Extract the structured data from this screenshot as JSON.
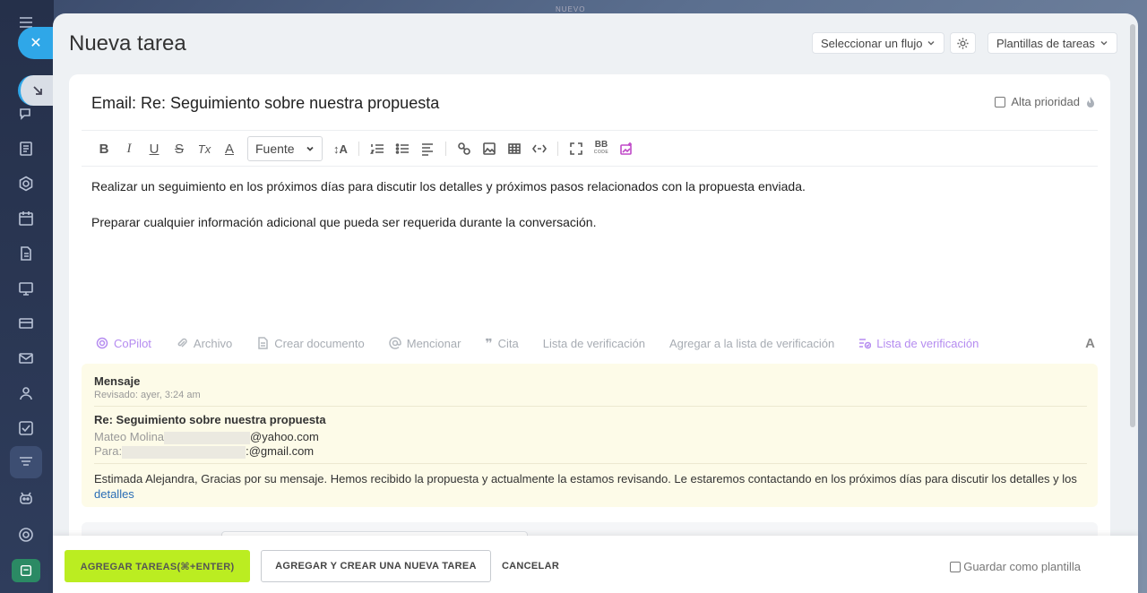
{
  "background": {
    "top_label": "NUEVO"
  },
  "modal": {
    "title": "Nueva tarea",
    "header": {
      "flow_select": "Seleccionar un flujo",
      "templates": "Plantillas de tareas"
    }
  },
  "task": {
    "title": "Email: Re: Seguimiento sobre nuestra propuesta",
    "priority_label": "Alta prioridad",
    "priority_checked": false,
    "toolbar": {
      "bold": "B",
      "italic": "I",
      "underline": "U",
      "strike": "S",
      "clear": "Tx",
      "color": "A",
      "font_select": "Fuente",
      "font_size": "↕A",
      "bbcode": "BB"
    },
    "body": [
      "Realizar un seguimiento en los próximos días para discutir los detalles y próximos pasos relacionados con la propuesta enviada.",
      "Preparar cualquier información adicional que pueda ser requerida durante la conversación."
    ],
    "actions": {
      "copilot": "CoPilot",
      "file": "Archivo",
      "create_doc": "Crear documento",
      "mention": "Mencionar",
      "quote": "Cita",
      "checklist": "Lista de verificación",
      "add_to_checklist": "Agregar a la lista de verificación",
      "checklist2": "Lista de verificación",
      "format": "A"
    }
  },
  "message": {
    "header": "Mensaje",
    "reviewed": "Revisado: ayer, 3:24 am",
    "subject": "Re: Seguimiento sobre nuestra propuesta",
    "from_name": "Mateo Molina",
    "from_email_suffix": "@yahoo.com",
    "to_label": "Para:",
    "to_email_suffix": ":@gmail.com",
    "preview": "Estimada Alejandra, Gracias por su mensaje. Hemos recibido la propuesta y actualmente la estamos revisando. Le estaremos contactando en los próximos días para discutir los detalles y los",
    "preview_link": "detalles"
  },
  "footer": {
    "primary": "AGREGAR TAREAS(⌘+ENTER)",
    "secondary": "AGREGAR Y CREAR UNA NUEVA TAREA",
    "cancel": "CANCELAR",
    "save_template": "Guardar como plantilla"
  },
  "colors": {
    "accent": "#bbed21",
    "close": "#2fa7e8",
    "copilot": "#b58cf0"
  }
}
